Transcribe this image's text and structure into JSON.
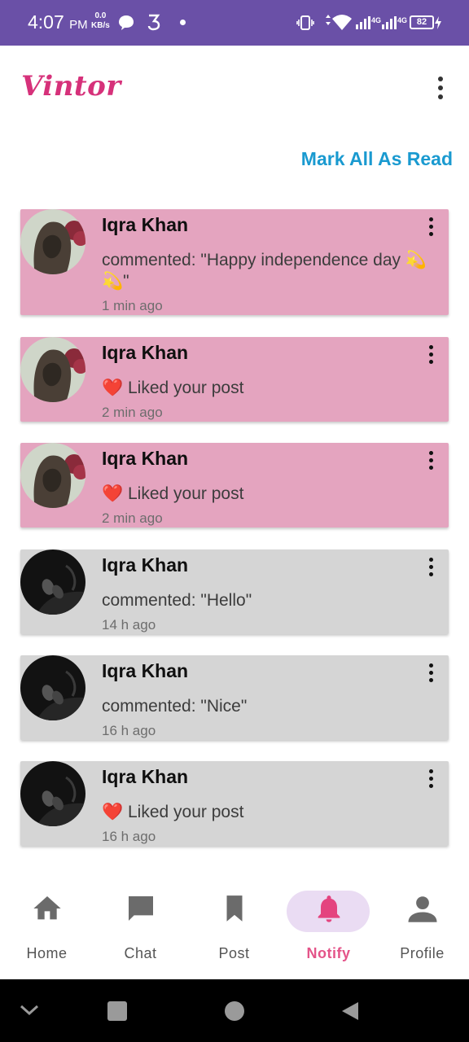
{
  "status_bar": {
    "time": "4:07",
    "ampm": "PM",
    "net_speed_value": "0.0",
    "net_speed_unit": "KB/s",
    "battery": "82",
    "network_labels": [
      "4G",
      "4G"
    ]
  },
  "header": {
    "app_title": "Vintor",
    "menu_icon": "more-vert-icon"
  },
  "mark_all_read": "Mark All As Read",
  "notifications": [
    {
      "name": "Iqra Khan",
      "message": "commented: \"Happy independence day 💫💫\"",
      "time": "1 min ago",
      "state": "unread"
    },
    {
      "name": "Iqra Khan",
      "message": "❤️ Liked your post",
      "time": "2 min ago",
      "state": "unread"
    },
    {
      "name": "Iqra Khan",
      "message": "❤️ Liked your post",
      "time": "2 min ago",
      "state": "unread"
    },
    {
      "name": "Iqra Khan",
      "message": "commented: \"Hello\"",
      "time": "14 h ago",
      "state": "read"
    },
    {
      "name": "Iqra Khan",
      "message": "commented: \"Nice\"",
      "time": "16 h ago",
      "state": "read"
    },
    {
      "name": "Iqra Khan",
      "message": "❤️ Liked your post",
      "time": "16 h ago",
      "state": "read"
    }
  ],
  "bottom_nav": [
    {
      "label": "Home",
      "icon": "home-icon",
      "active": false
    },
    {
      "label": "Chat",
      "icon": "chat-icon",
      "active": false
    },
    {
      "label": "Post",
      "icon": "bookmark-icon",
      "active": false
    },
    {
      "label": "Notify",
      "icon": "bell-icon",
      "active": true
    },
    {
      "label": "Profile",
      "icon": "person-icon",
      "active": false
    }
  ],
  "colors": {
    "status_bar": "#6a50a7",
    "brand": "#d6317a",
    "link": "#1a9ad0",
    "unread_card": "#e4a4bf",
    "read_card": "#d5d5d5",
    "active_nav": "#e45489",
    "active_pill": "#eadcf3"
  }
}
